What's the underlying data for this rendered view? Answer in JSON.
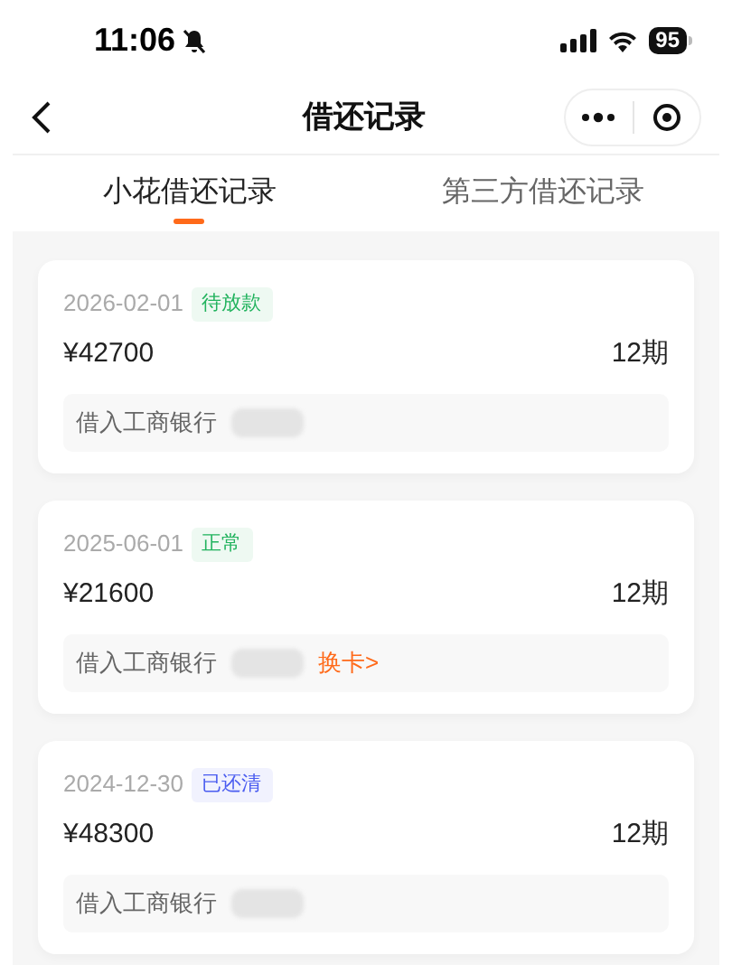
{
  "status_bar": {
    "time": "11:06",
    "battery": "95"
  },
  "nav": {
    "title": "借还记录"
  },
  "tabs": [
    {
      "label": "小花借还记录",
      "selected": true
    },
    {
      "label": "第三方借还记录",
      "selected": false
    }
  ],
  "records": [
    {
      "date": "2026-02-01",
      "status": "待放款",
      "color": "#22b35e",
      "amount": "¥42700",
      "term": "12期",
      "bank": "借入工商银行"
    },
    {
      "date": "2025-06-01",
      "status": "正常",
      "color": "#22b35e",
      "amount": "¥21600",
      "term": "12期",
      "bank": "借入工商银行",
      "action": "换卡>"
    },
    {
      "date": "2024-12-30",
      "status": "已还清",
      "color": "#4a5cf0",
      "amount": "¥48300",
      "term": "12期",
      "bank": "借入工商银行"
    }
  ]
}
